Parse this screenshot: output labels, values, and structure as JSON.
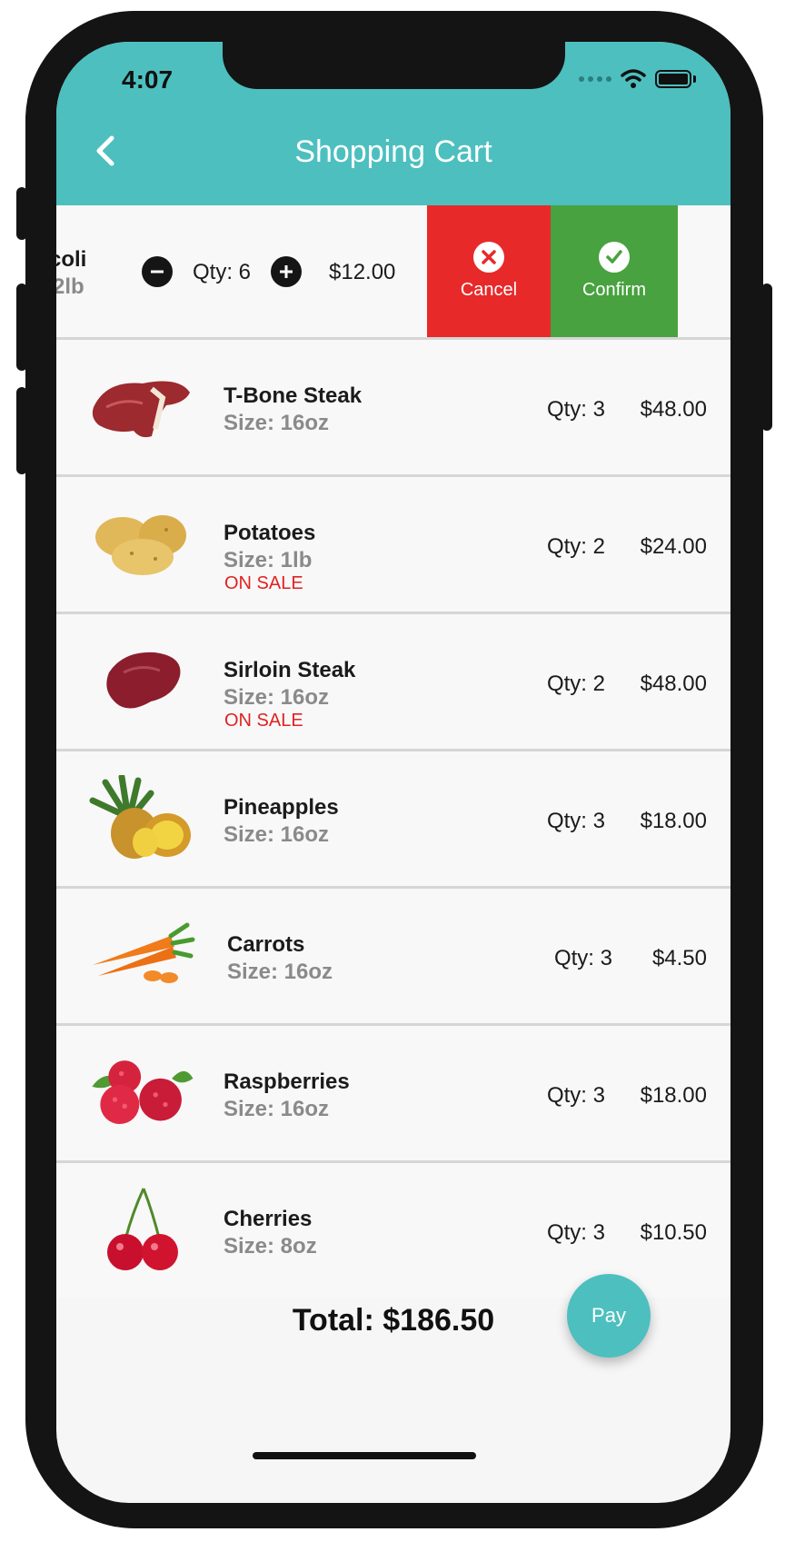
{
  "status": {
    "time": "4:07"
  },
  "appbar": {
    "title": "Shopping Cart"
  },
  "swiped_item": {
    "name_fragment": "coli",
    "size_fragment": "2lb",
    "qty": "Qty: 6",
    "price": "$12.00",
    "cancel_label": "Cancel",
    "confirm_label": "Confirm"
  },
  "items": [
    {
      "name": "T-Bone Steak",
      "size": "Size: 16oz",
      "sale": "",
      "qty": "Qty: 3",
      "price": "$48.00",
      "icon": "t-bone-steak-image"
    },
    {
      "name": "Potatoes",
      "size": "Size: 1lb",
      "sale": "ON SALE",
      "qty": "Qty: 2",
      "price": "$24.00",
      "icon": "potatoes-image"
    },
    {
      "name": "Sirloin Steak",
      "size": "Size: 16oz",
      "sale": "ON SALE",
      "qty": "Qty: 2",
      "price": "$48.00",
      "icon": "sirloin-steak-image"
    },
    {
      "name": "Pineapples",
      "size": "Size: 16oz",
      "sale": "",
      "qty": "Qty: 3",
      "price": "$18.00",
      "icon": "pineapple-image"
    },
    {
      "name": "Carrots",
      "size": "Size: 16oz",
      "sale": "",
      "qty": "Qty: 3",
      "price": "$4.50",
      "icon": "carrots-image"
    },
    {
      "name": "Raspberries",
      "size": "Size: 16oz",
      "sale": "",
      "qty": "Qty: 3",
      "price": "$18.00",
      "icon": "raspberries-image"
    },
    {
      "name": "Cherries",
      "size": "Size: 8oz",
      "sale": "",
      "qty": "Qty: 3",
      "price": "$10.50",
      "icon": "cherries-image"
    }
  ],
  "footer": {
    "total": "Total: $186.50",
    "pay_label": "Pay"
  },
  "colors": {
    "accent": "#4dbfbf",
    "cancel": "#e8292a",
    "confirm": "#48a23f",
    "sale": "#e02222"
  }
}
